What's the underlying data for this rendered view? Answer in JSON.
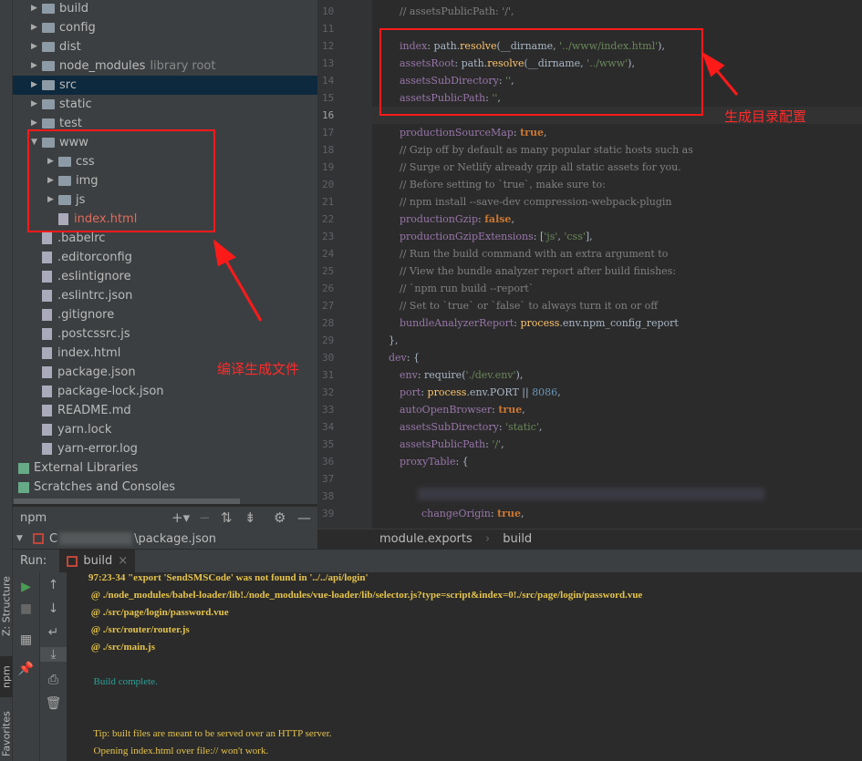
{
  "left_strip": {
    "tabs": [
      "Z: Structure",
      "npm",
      "Favorites"
    ]
  },
  "project_tree": {
    "items": [
      {
        "label": "build",
        "type": "folder",
        "depth": 0,
        "expanded": false
      },
      {
        "label": "config",
        "type": "folder",
        "depth": 0,
        "expanded": false
      },
      {
        "label": "dist",
        "type": "folder",
        "depth": 0,
        "expanded": false
      },
      {
        "label": "node_modules",
        "type": "folder",
        "depth": 0,
        "expanded": false,
        "hint": "library root"
      },
      {
        "label": "src",
        "type": "folder",
        "depth": 0,
        "expanded": false,
        "selected": true
      },
      {
        "label": "static",
        "type": "folder",
        "depth": 0,
        "expanded": false
      },
      {
        "label": "test",
        "type": "folder",
        "depth": 0,
        "expanded": false
      },
      {
        "label": "www",
        "type": "folder",
        "depth": 0,
        "expanded": true
      },
      {
        "label": "css",
        "type": "folder",
        "depth": 1,
        "expanded": false
      },
      {
        "label": "img",
        "type": "folder",
        "depth": 1,
        "expanded": false
      },
      {
        "label": "js",
        "type": "folder",
        "depth": 1,
        "expanded": false
      },
      {
        "label": "index.html",
        "type": "file",
        "depth": 1,
        "color": "#e06c5c"
      },
      {
        "label": ".babelrc",
        "type": "file",
        "depth": 0
      },
      {
        "label": ".editorconfig",
        "type": "file",
        "depth": 0
      },
      {
        "label": ".eslintignore",
        "type": "file",
        "depth": 0
      },
      {
        "label": ".eslintrc.json",
        "type": "file",
        "depth": 0
      },
      {
        "label": ".gitignore",
        "type": "file",
        "depth": 0
      },
      {
        "label": ".postcssrc.js",
        "type": "file",
        "depth": 0
      },
      {
        "label": "index.html",
        "type": "file",
        "depth": 0
      },
      {
        "label": "package.json",
        "type": "file",
        "depth": 0
      },
      {
        "label": "package-lock.json",
        "type": "file",
        "depth": 0
      },
      {
        "label": "README.md",
        "type": "file",
        "depth": 0
      },
      {
        "label": "yarn.lock",
        "type": "file",
        "depth": 0
      },
      {
        "label": "yarn-error.log",
        "type": "file",
        "depth": 0
      },
      {
        "label": "External Libraries",
        "type": "lib",
        "depth": -1
      },
      {
        "label": "Scratches and Consoles",
        "type": "lib",
        "depth": -1
      }
    ]
  },
  "npm_panel": {
    "title": "npm",
    "package_label_prefix": "C",
    "package_label_suffix": "\\package.json"
  },
  "editor": {
    "first_line": 10,
    "current_line": 16,
    "lines": [
      [
        [
          "// assetsPublicPath: '/',",
          "c"
        ]
      ],
      [],
      [
        [
          "index",
          "k"
        ],
        [
          ": path.",
          "w"
        ],
        [
          "resolve",
          "f"
        ],
        [
          "(__dirname, ",
          "w"
        ],
        [
          "'../www/index.html'",
          "s"
        ],
        [
          "),",
          "w"
        ]
      ],
      [
        [
          "assetsRoot",
          "k"
        ],
        [
          ": path.",
          "w"
        ],
        [
          "resolve",
          "f"
        ],
        [
          "(__dirname, ",
          "w"
        ],
        [
          "'../www'",
          "s"
        ],
        [
          "),",
          "w"
        ]
      ],
      [
        [
          "assetsSubDirectory",
          "k"
        ],
        [
          ": ",
          "w"
        ],
        [
          "''",
          "s"
        ],
        [
          ",",
          "w"
        ]
      ],
      [
        [
          "assetsPublicPath",
          "k"
        ],
        [
          ": ",
          "w"
        ],
        [
          "''",
          "s"
        ],
        [
          ",",
          "w"
        ]
      ],
      [],
      [
        [
          "productionSourceMap",
          "k"
        ],
        [
          ": ",
          "w"
        ],
        [
          "true",
          "b"
        ],
        [
          ",",
          "w"
        ]
      ],
      [
        [
          "// Gzip off by default as many popular static hosts such as",
          "c"
        ]
      ],
      [
        [
          "// Surge or Netlify already gzip all static assets for you.",
          "c"
        ]
      ],
      [
        [
          "// Before setting to `true`, make sure to:",
          "c"
        ]
      ],
      [
        [
          "// npm install --save-dev compression-webpack-plugin",
          "c"
        ]
      ],
      [
        [
          "productionGzip",
          "k"
        ],
        [
          ": ",
          "w"
        ],
        [
          "false",
          "b"
        ],
        [
          ",",
          "w"
        ]
      ],
      [
        [
          "productionGzipExtensions",
          "k"
        ],
        [
          ": [",
          "w"
        ],
        [
          "'js'",
          "s"
        ],
        [
          ", ",
          "w"
        ],
        [
          "'css'",
          "s"
        ],
        [
          "],",
          "w"
        ]
      ],
      [
        [
          "// Run the build command with an extra argument to",
          "c"
        ]
      ],
      [
        [
          "// View the bundle analyzer report after build finishes:",
          "c"
        ]
      ],
      [
        [
          "// `npm run build --report`",
          "c"
        ]
      ],
      [
        [
          "// Set to `true` or `false` to always turn it on or off",
          "c"
        ]
      ],
      [
        [
          "bundleAnalyzerReport",
          "k"
        ],
        [
          ": ",
          "w"
        ],
        [
          "process",
          "f"
        ],
        [
          ".env.npm_config_report",
          "w"
        ]
      ],
      [
        [
          "},",
          "w"
        ]
      ],
      [
        [
          "dev",
          "k"
        ],
        [
          ": {",
          "w"
        ]
      ],
      [
        [
          "env",
          "k"
        ],
        [
          ": require(",
          "w"
        ],
        [
          "'./dev.env'",
          "s"
        ],
        [
          "),",
          "w"
        ]
      ],
      [
        [
          "port",
          "k"
        ],
        [
          ": ",
          "w"
        ],
        [
          "process",
          "f"
        ],
        [
          ".env.PORT || ",
          "w"
        ],
        [
          "8086",
          "n"
        ],
        [
          ",",
          "w"
        ]
      ],
      [
        [
          "autoOpenBrowser",
          "k"
        ],
        [
          ": ",
          "w"
        ],
        [
          "true",
          "b"
        ],
        [
          ",",
          "w"
        ]
      ],
      [
        [
          "assetsSubDirectory",
          "k"
        ],
        [
          ": ",
          "w"
        ],
        [
          "'static'",
          "s"
        ],
        [
          ",",
          "w"
        ]
      ],
      [
        [
          "assetsPublicPath",
          "k"
        ],
        [
          ": ",
          "w"
        ],
        [
          "'/'",
          "s"
        ],
        [
          ",",
          "w"
        ]
      ],
      [
        [
          "proxyTable",
          "k"
        ],
        [
          ": {",
          "w"
        ]
      ],
      [],
      [],
      [
        [
          "changeOrigin",
          "k"
        ],
        [
          ": ",
          "w"
        ],
        [
          "true",
          "b"
        ],
        [
          ",",
          "w"
        ]
      ]
    ]
  },
  "breadcrumb": [
    "module.exports",
    "build"
  ],
  "run_panel": {
    "label": "Run:",
    "tab": "build",
    "output": [
      {
        "text": "97:23-34 \"export 'SendSMSCode' was not found in '../../api/login'",
        "style": "warn"
      },
      {
        "text": " @ ./node_modules/babel-loader/lib!./node_modules/vue-loader/lib/selector.js?type=script&index=0!./src/page/login/password.vue",
        "style": "warn"
      },
      {
        "text": " @ ./src/page/login/password.vue",
        "style": "warn"
      },
      {
        "text": " @ ./src/router/router.js",
        "style": "warn"
      },
      {
        "text": " @ ./src/main.js",
        "style": "warn"
      },
      {
        "text": "",
        "style": "warn"
      },
      {
        "text": "  Build complete.",
        "style": "ok"
      },
      {
        "text": "",
        "style": "warn"
      },
      {
        "text": "",
        "style": "warn"
      },
      {
        "text": "  Tip: built files are meant to be served over an HTTP server.",
        "style": "tip"
      },
      {
        "text": "  Opening index.html over file:// won't work.",
        "style": "tip"
      }
    ]
  },
  "annotations": {
    "config_note": "生成目录配置",
    "output_note": "编译生成文件",
    "color": "#ff1a1a"
  }
}
